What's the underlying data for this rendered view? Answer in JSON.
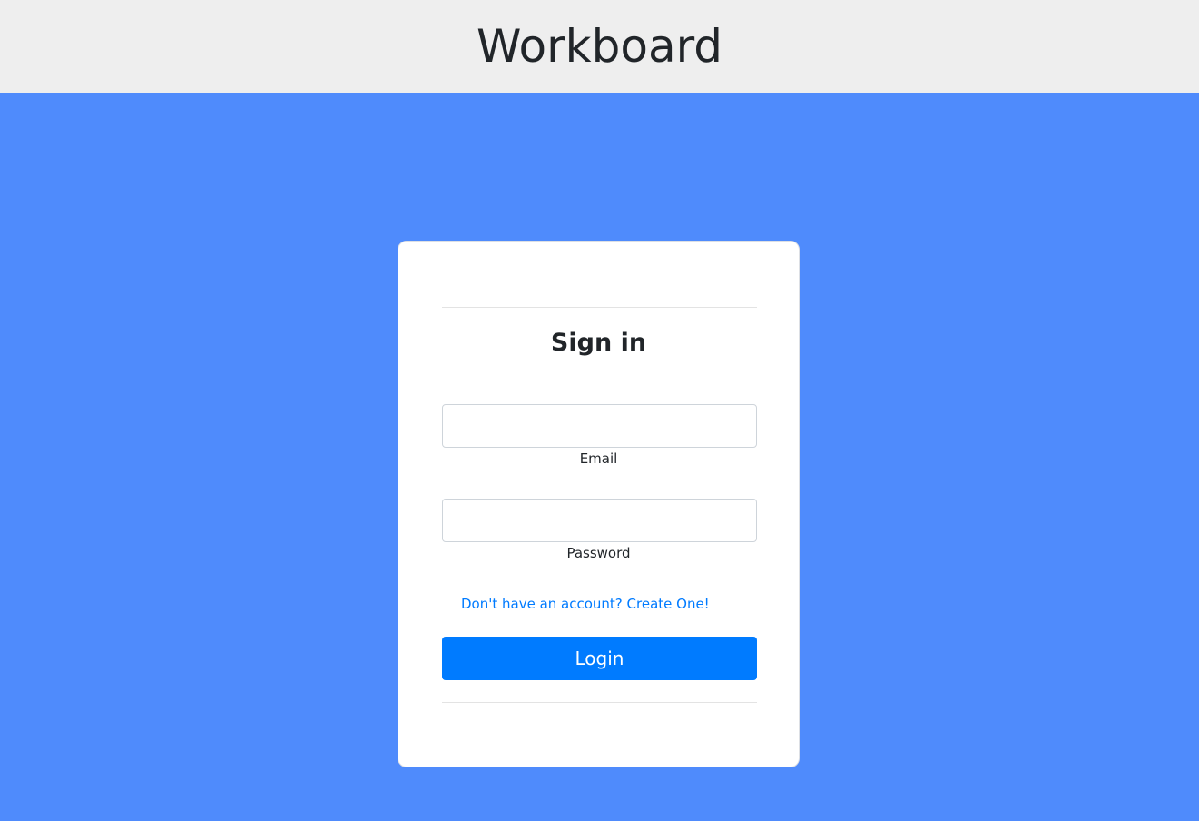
{
  "header": {
    "title": "Workboard"
  },
  "login_card": {
    "title": "Sign in",
    "email_label": "Email",
    "email_value": "",
    "password_label": "Password",
    "password_value": "",
    "signup_link": "Don't have an account? Create One!",
    "login_button": "Login"
  },
  "colors": {
    "header_bg": "#eeeeee",
    "page_bg": "#4f8bfc",
    "card_bg": "#ffffff",
    "primary": "#007bff",
    "link": "#007bff"
  }
}
